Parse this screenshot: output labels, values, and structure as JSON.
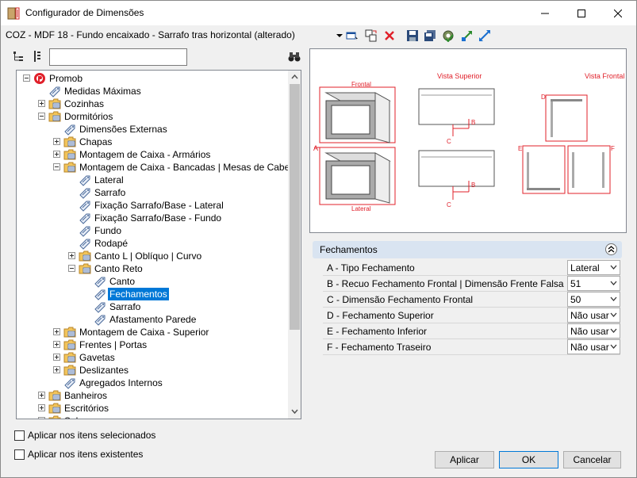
{
  "window": {
    "title": "Configurador de Dimensões"
  },
  "toolbar": {
    "document_title": "COZ - MDF 18 - Fundo encaixado - Sarrafo tras horizontal (alterado)"
  },
  "search": {
    "value": "",
    "placeholder": ""
  },
  "tree": {
    "items": [
      {
        "label": "Promob"
      },
      {
        "label": "Medidas Máximas"
      },
      {
        "label": "Cozinhas"
      },
      {
        "label": "Dormitórios"
      },
      {
        "label": "Dimensões Externas"
      },
      {
        "label": "Chapas"
      },
      {
        "label": "Montagem de Caixa - Armários"
      },
      {
        "label": "Montagem de Caixa - Bancadas | Mesas de Cabeceira"
      },
      {
        "label": "Lateral"
      },
      {
        "label": "Sarrafo"
      },
      {
        "label": "Fixação Sarrafo/Base - Lateral"
      },
      {
        "label": "Fixação Sarrafo/Base - Fundo"
      },
      {
        "label": "Fundo"
      },
      {
        "label": "Rodapé"
      },
      {
        "label": "Canto L | Oblíquo | Curvo"
      },
      {
        "label": "Canto Reto"
      },
      {
        "label": "Canto"
      },
      {
        "label": "Fechamentos"
      },
      {
        "label": "Sarrafo"
      },
      {
        "label": "Afastamento Parede"
      },
      {
        "label": "Montagem de Caixa - Superior"
      },
      {
        "label": "Frentes | Portas"
      },
      {
        "label": "Gavetas"
      },
      {
        "label": "Deslizantes"
      },
      {
        "label": "Agregados Internos"
      },
      {
        "label": "Banheiros"
      },
      {
        "label": "Escritórios"
      },
      {
        "label": "Sala"
      }
    ]
  },
  "preview": {
    "labels": {
      "frontal": "Frontal",
      "lateral": "Lateral",
      "vista_superior": "Vista Superior",
      "vista_frontal": "Vista Frontal",
      "a": "A",
      "b1": "B",
      "c1": "C",
      "b2": "B",
      "c2": "C",
      "d": "D",
      "e": "E",
      "f": "F"
    }
  },
  "properties": {
    "section_title": "Fechamentos",
    "rows": [
      {
        "name": "A - Tipo Fechamento",
        "value": "Lateral"
      },
      {
        "name": "B - Recuo Fechamento Frontal | Dimensão Frente Falsa Parcial",
        "value": "51"
      },
      {
        "name": "C - Dimensão Fechamento Frontal",
        "value": "50"
      },
      {
        "name": "D - Fechamento Superior",
        "value": "Não usar"
      },
      {
        "name": "E - Fechamento Inferior",
        "value": "Não usar"
      },
      {
        "name": "F - Fechamento Traseiro",
        "value": "Não usar"
      }
    ]
  },
  "options": {
    "apply_selected": "Aplicar nos itens selecionados",
    "apply_existing": "Aplicar nos itens existentes"
  },
  "buttons": {
    "apply": "Aplicar",
    "ok": "OK",
    "cancel": "Cancelar"
  },
  "colors": {
    "accent": "#0078d7",
    "drawing_red": "#e0202a",
    "section_bg": "#d9e4f1"
  }
}
